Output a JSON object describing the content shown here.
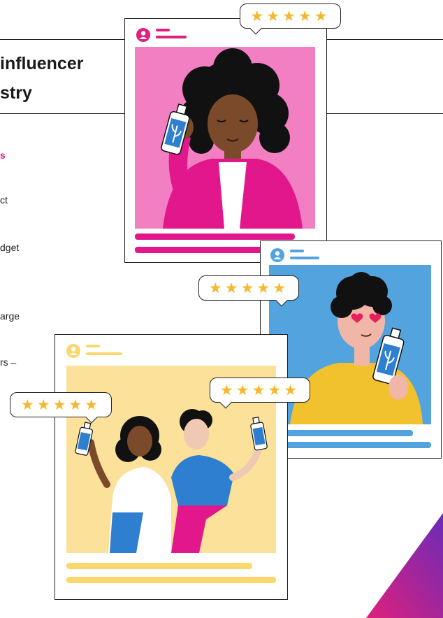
{
  "slide": {
    "title_lines": [
      "influencer",
      "stry"
    ],
    "subheading": "s",
    "body_fragments": [
      "ct",
      "dget",
      "arge",
      "rs –"
    ]
  },
  "cards": {
    "woman_card": {
      "rating": "★★★★★",
      "photo_bg": "#f37fc3"
    },
    "man_card": {
      "rating": "★★★★★",
      "photo_bg": "#53a3de"
    },
    "couple_card": {
      "rating_left": "★★★★★",
      "rating_right": "★★★★★",
      "photo_bg": "#fbe19a"
    }
  },
  "colors": {
    "accent_pink": "#e0207c",
    "accent_blue": "#53a3de",
    "accent_yellow": "#fbd86e",
    "star": "#f5b82e"
  },
  "icons": [
    "user-avatar-icon",
    "star-icon",
    "product-bottle-icon",
    "heart-eye-icon"
  ]
}
